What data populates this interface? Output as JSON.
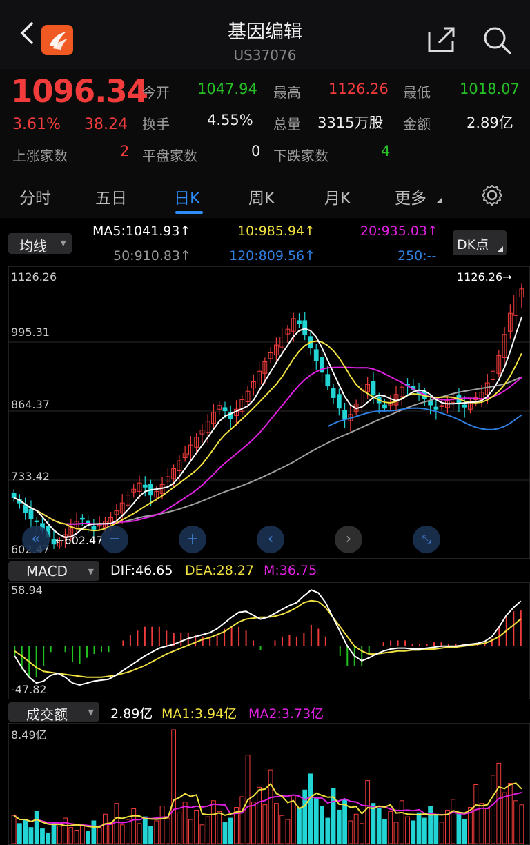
{
  "header": {
    "title": "基因编辑",
    "code": "US37076"
  },
  "quote": {
    "price": "1096.34",
    "pct": "3.61%",
    "change": "38.24",
    "stats": [
      {
        "label": "今开",
        "value": "1047.94",
        "color": "green"
      },
      {
        "label": "最高",
        "value": "1126.26",
        "color": "red"
      },
      {
        "label": "最低",
        "value": "1018.07",
        "color": "green"
      },
      {
        "label": "换手",
        "value": "4.55%",
        "color": "white"
      },
      {
        "label": "总量",
        "value": "3315万股",
        "color": "white"
      },
      {
        "label": "金额",
        "value": "2.89亿",
        "color": "white"
      },
      {
        "label": "上涨家数",
        "value": "2",
        "color": "red"
      },
      {
        "label": "平盘家数",
        "value": "0",
        "color": "white"
      },
      {
        "label": "下跌家数",
        "value": "4",
        "color": "green"
      }
    ]
  },
  "tabs": [
    "分时",
    "五日",
    "日K",
    "周K",
    "月K",
    "更多"
  ],
  "active_tab": "日K",
  "ma_panel": {
    "selector": "均线",
    "dk": "DK点",
    "ma5": "MA5:1041.93↑",
    "ma10": "10:985.94↑",
    "ma20": "20:935.03↑",
    "ma50": "50:910.83↑",
    "ma120": "120:809.56↑",
    "ma250": "250:--",
    "axis": [
      "1126.26",
      "995.31",
      "864.37",
      "733.42",
      "602.47"
    ],
    "high_marker": "1126.26→",
    "low_marker": "←602.47"
  },
  "macd_panel": {
    "selector": "MACD",
    "dif": "DIF:46.65",
    "dea": "DEA:28.27",
    "m": "M:36.75",
    "axis_top": "58.94",
    "axis_bottom": "-47.82"
  },
  "vol_panel": {
    "selector": "成交额",
    "value": "2.89亿",
    "ma1": "MA1:3.94亿",
    "ma2": "MA2:3.73亿",
    "axis_top": "8.49亿"
  },
  "colors": {
    "up": "#f23c3c",
    "down": "#22d4d4",
    "ma5": "#ffffff",
    "ma10": "#f0e040",
    "ma20": "#e020e0",
    "ma50": "#a0a0a0",
    "ma120": "#2f7fe0",
    "macd_down": "#20c020"
  },
  "chart_data": {
    "type": "candlestick",
    "y_range": [
      602.47,
      1126.26
    ],
    "close": [
      700,
      690,
      672,
      660,
      655,
      640,
      625,
      612,
      618,
      630,
      645,
      655,
      660,
      650,
      640,
      648,
      655,
      662,
      675,
      690,
      705,
      716,
      728,
      720,
      705,
      712,
      725,
      740,
      755,
      770,
      785,
      800,
      815,
      828,
      845,
      862,
      875,
      865,
      850,
      868,
      886,
      902,
      920,
      940,
      958,
      975,
      990,
      1005,
      1020,
      1040,
      1030,
      1010,
      985,
      960,
      938,
      912,
      890,
      870,
      850,
      858,
      878,
      905,
      915,
      895,
      880,
      870,
      880,
      896,
      910,
      915,
      905,
      895,
      888,
      876,
      868,
      875,
      885,
      888,
      880,
      872,
      880,
      890,
      900,
      918,
      940,
      970,
      1010,
      1050,
      1085,
      1096.34
    ],
    "macd_dif": [
      -10,
      -22,
      -32,
      -38,
      -36,
      -30,
      -28,
      -32,
      -38,
      -40,
      -38,
      -36,
      -35,
      -34,
      -30,
      -25,
      -20,
      -15,
      -10,
      -6,
      -2,
      0,
      2,
      5,
      8,
      10,
      12,
      14,
      18,
      24,
      30,
      35,
      36,
      32,
      28,
      30,
      34,
      38,
      42,
      45,
      52,
      58,
      55,
      45,
      30,
      15,
      0,
      -10,
      -15,
      -12,
      -8,
      -5,
      -3,
      -2,
      -2,
      -3,
      -3,
      -2,
      -1,
      0,
      0,
      0,
      1,
      2,
      3,
      5,
      10,
      20,
      32,
      40,
      46.65
    ],
    "macd_dea": [
      -5,
      -10,
      -16,
      -22,
      -26,
      -27,
      -28,
      -29,
      -30,
      -31,
      -32,
      -32,
      -32,
      -31,
      -30,
      -28,
      -26,
      -23,
      -20,
      -16,
      -12,
      -8,
      -5,
      -2,
      1,
      4,
      7,
      9,
      12,
      15,
      20,
      25,
      28,
      29,
      30,
      30,
      31,
      33,
      36,
      40,
      45,
      47,
      46,
      40,
      30,
      20,
      10,
      0,
      -5,
      -8,
      -8,
      -7,
      -6,
      -5,
      -5,
      -4,
      -4,
      -3,
      -3,
      -2,
      -1,
      -1,
      0,
      1,
      2,
      3,
      6,
      10,
      16,
      22,
      28.27
    ],
    "volume": [
      2.1,
      1.5,
      1.8,
      1.2,
      2.4,
      1.1,
      0.8,
      1.6,
      1.3,
      1.9,
      1.2,
      1.0,
      1.4,
      0.9,
      1.7,
      1.2,
      2.2,
      1.6,
      3.0,
      1.4,
      1.8,
      2.6,
      1.5,
      2.0,
      1.3,
      1.7,
      2.8,
      1.9,
      8.49,
      2.3,
      3.1,
      1.8,
      2.5,
      1.4,
      2.0,
      3.2,
      2.4,
      1.6,
      1.9,
      2.7,
      3.5,
      6.6,
      3.1,
      4.2,
      2.9,
      5.5,
      3.0,
      2.1,
      1.8,
      3.6,
      2.6,
      4.0,
      5.2,
      3.4,
      2.8,
      1.9,
      4.1,
      2.5,
      3.3,
      1.7,
      2.2,
      1.5,
      4.7,
      3.0,
      2.6,
      1.8,
      2.4,
      1.6,
      3.2,
      2.0,
      1.7,
      2.3,
      1.9,
      2.8,
      2.1,
      1.6,
      2.5,
      3.3,
      2.2,
      1.8,
      2.7,
      4.4,
      3.0,
      2.6,
      5.1,
      6.0,
      3.8,
      4.5,
      3.2,
      2.89
    ],
    "vol_ma1": [
      3.94
    ],
    "vol_ma2": [
      3.73
    ]
  }
}
